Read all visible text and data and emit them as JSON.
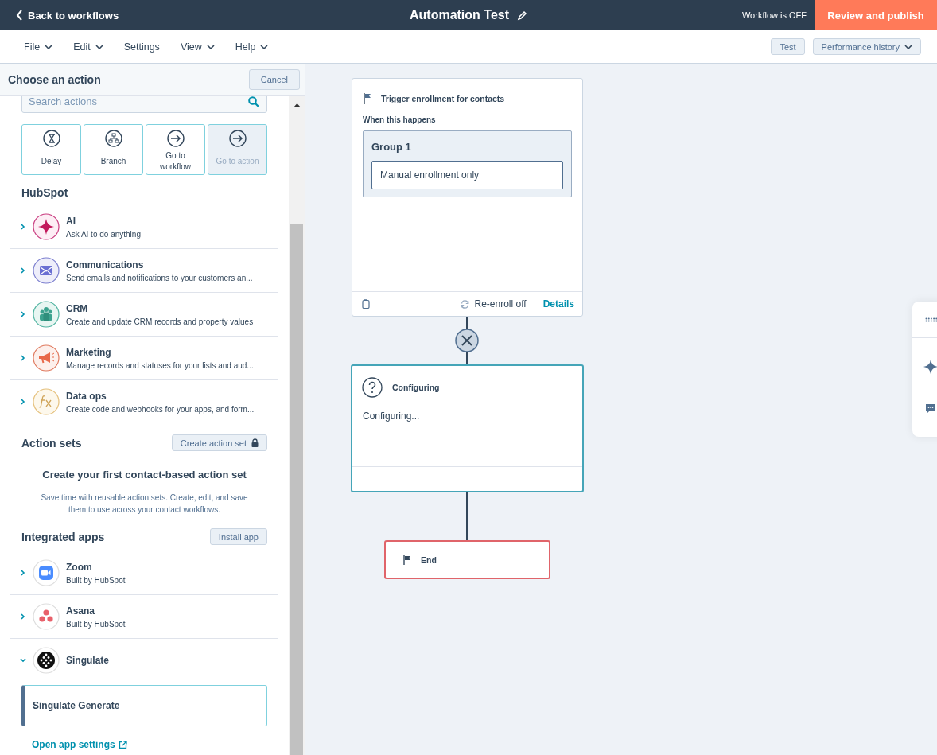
{
  "topbar": {
    "back_link": "Back to workflows",
    "title": "Automation Test",
    "status": "Workflow is OFF",
    "publish_button": "Review and publish"
  },
  "menu": {
    "items": [
      {
        "label": "File",
        "dropdown": true
      },
      {
        "label": "Edit",
        "dropdown": true
      },
      {
        "label": "Settings",
        "dropdown": false
      },
      {
        "label": "View",
        "dropdown": true
      },
      {
        "label": "Help",
        "dropdown": true
      }
    ],
    "buttons": [
      {
        "label": "Test",
        "dropdown": false
      },
      {
        "label": "Performance history",
        "dropdown": true
      }
    ]
  },
  "panel": {
    "title": "Choose an action",
    "cancel_button": "Cancel",
    "search": {
      "placeholder": "Search actions"
    },
    "quick_actions": [
      {
        "label": "Delay",
        "kind": "delay",
        "disabled": false
      },
      {
        "label": "Branch",
        "kind": "branch",
        "disabled": false
      },
      {
        "label": "Go to workflow",
        "kind": "goto",
        "disabled": false
      },
      {
        "label": "Go to action",
        "kind": "goto",
        "disabled": true
      }
    ],
    "hubspot_heading": "HubSpot",
    "categories": [
      {
        "name": "AI",
        "description": "Ask AI to do anything",
        "kind": "ai",
        "expanded": false
      },
      {
        "name": "Communications",
        "description": "Send emails and notifications to your customers an...",
        "kind": "communications",
        "expanded": false
      },
      {
        "name": "CRM",
        "description": "Create and update CRM records and property values",
        "kind": "crm",
        "expanded": false
      },
      {
        "name": "Marketing",
        "description": "Manage records and statuses for your lists and aud...",
        "kind": "marketing",
        "expanded": false
      },
      {
        "name": "Data ops",
        "description": "Create code and webhooks for your apps, and form...",
        "kind": "dataops",
        "expanded": false
      }
    ],
    "action_sets": {
      "heading": "Action sets",
      "button": "Create action set",
      "empty_title": "Create your first contact-based action set",
      "empty_text": "Save time with reusable action sets. Create, edit, and save them to use across your contact workflows."
    },
    "apps_heading": "Integrated apps",
    "install_button": "Install app",
    "apps": [
      {
        "name": "Zoom",
        "description": "Built by HubSpot",
        "kind": "video",
        "expanded": false
      },
      {
        "name": "Asana",
        "description": "Built by HubSpot",
        "kind": "tasks",
        "expanded": false
      },
      {
        "name": "Singulate",
        "kind": "generator",
        "expanded": true,
        "actions": [
          "Singulate Generate"
        ]
      }
    ],
    "app_settings_link": "Open app settings"
  },
  "canvas": {
    "trigger": {
      "title": "Trigger enrollment for contacts",
      "subtitle": "When this happens",
      "group_title": "Group 1",
      "criteria": "Manual enrollment only",
      "reenroll": "Re-enroll off",
      "details_link": "Details"
    },
    "action": {
      "title": "Configuring",
      "body": "Configuring..."
    },
    "end": {
      "title": "End"
    }
  }
}
